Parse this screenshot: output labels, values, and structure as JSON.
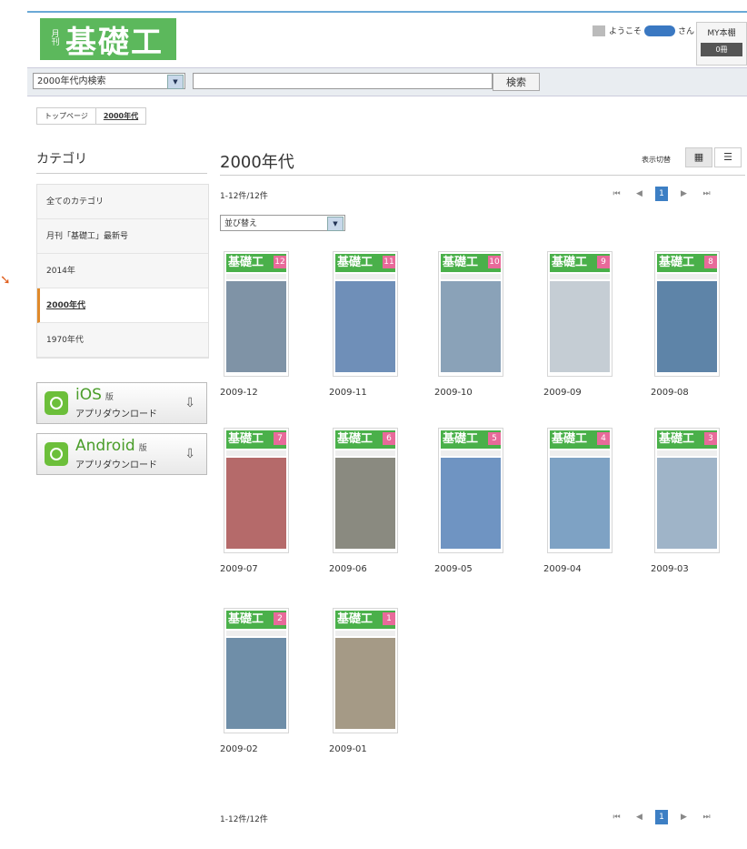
{
  "header": {
    "logo_month": "月刊",
    "logo_title": "基礎工",
    "welcome_prefix": "ようこそ",
    "welcome_suffix": "さん",
    "mybook_label": "MY本棚",
    "mybook_count": "0冊"
  },
  "search": {
    "scope": "2000年代内検索",
    "button": "検索"
  },
  "breadcrumb": [
    "トップページ",
    "2000年代"
  ],
  "sidebar": {
    "heading": "カテゴリ",
    "items": [
      {
        "label": "全てのカテゴリ",
        "active": false
      },
      {
        "label": "月刊「基礎工」最新号",
        "active": false
      },
      {
        "label": "2014年",
        "active": false
      },
      {
        "label": "2000年代",
        "active": true
      },
      {
        "label": "1970年代",
        "active": false
      }
    ],
    "apps": [
      {
        "name": "iOS",
        "ban": "版",
        "sub": "アプリダウンロード"
      },
      {
        "name": "Android",
        "ban": "版",
        "sub": "アプリダウンロード"
      }
    ]
  },
  "main": {
    "title": "2000年代",
    "view_toggle_label": "表示切替",
    "count_text": "1-12件/12件",
    "current_page": "1",
    "sort_label": "並び替え",
    "cover_brand": "基礎工",
    "issues": [
      {
        "label": "2009-12",
        "issue_no": "12",
        "color": "#7f93a6"
      },
      {
        "label": "2009-11",
        "issue_no": "11",
        "color": "#6f8fb8"
      },
      {
        "label": "2009-10",
        "issue_no": "10",
        "color": "#8aa2b8"
      },
      {
        "label": "2009-09",
        "issue_no": "9",
        "color": "#c5cdd4"
      },
      {
        "label": "2009-08",
        "issue_no": "8",
        "color": "#5e84a8"
      },
      {
        "label": "2009-07",
        "issue_no": "7",
        "color": "#b56a6a"
      },
      {
        "label": "2009-06",
        "issue_no": "6",
        "color": "#8a8a80"
      },
      {
        "label": "2009-05",
        "issue_no": "5",
        "color": "#6f94c2"
      },
      {
        "label": "2009-04",
        "issue_no": "4",
        "color": "#7ea2c4"
      },
      {
        "label": "2009-03",
        "issue_no": "3",
        "color": "#9fb4c8"
      },
      {
        "label": "2009-02",
        "issue_no": "2",
        "color": "#6f8ea8"
      },
      {
        "label": "2009-01",
        "issue_no": "1",
        "color": "#a59a86"
      }
    ]
  },
  "colors": {
    "brand_green": "#5cb85c",
    "active_orange": "#e08a2b",
    "pager_blue": "#3d7fc4",
    "issue_pink": "#e86a9a"
  }
}
